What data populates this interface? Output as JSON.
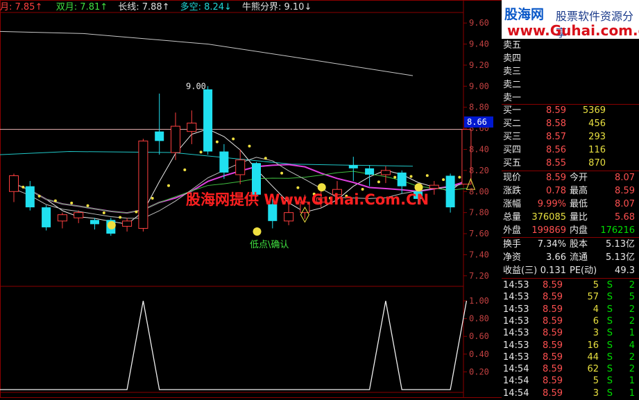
{
  "header": {
    "items": [
      {
        "label": "月:",
        "value": "7.85",
        "arrow": "↑",
        "color": "#ff4040"
      },
      {
        "label": "双月:",
        "value": "7.81",
        "arrow": "↑",
        "color": "#40e040"
      },
      {
        "label": "长线:",
        "value": "7.88",
        "arrow": "↑",
        "color": "#e0e0e0"
      },
      {
        "label": "多空:",
        "value": "8.24",
        "arrow": "↓",
        "color": "#20d8d8"
      },
      {
        "label": "牛熊分界:",
        "value": "9.10",
        "arrow": "↓",
        "color": "#e0e0e0"
      }
    ]
  },
  "price_axis": {
    "ticks": [
      "9.60",
      "9.40",
      "9.20",
      "9.00",
      "8.80",
      "8.60",
      "8.40",
      "8.20",
      "8.00",
      "7.80",
      "7.60",
      "7.40",
      "7.20"
    ],
    "current": "8.66"
  },
  "indicator_axis": {
    "ticks": [
      "1.00",
      "0.80",
      "0.60",
      "0.40",
      "0.20"
    ]
  },
  "annotations": {
    "high_label": "9.00",
    "low_label": "低点\\确认",
    "watermark": "股海网提供 Www.Guhai.Com.CN"
  },
  "chart_data": {
    "type": "candlestick",
    "candles": [
      {
        "o": 8.0,
        "c": 8.15,
        "h": 8.17,
        "l": 7.9,
        "up": true
      },
      {
        "o": 8.05,
        "c": 7.85,
        "h": 8.1,
        "l": 7.82,
        "up": false
      },
      {
        "o": 7.85,
        "c": 7.66,
        "h": 7.87,
        "l": 7.63,
        "up": false
      },
      {
        "o": 7.72,
        "c": 7.78,
        "h": 7.8,
        "l": 7.65,
        "up": true
      },
      {
        "o": 7.75,
        "c": 7.8,
        "h": 7.82,
        "l": 7.7,
        "up": true
      },
      {
        "o": 7.73,
        "c": 7.69,
        "h": 7.75,
        "l": 7.64,
        "up": false
      },
      {
        "o": 7.73,
        "c": 7.6,
        "h": 7.75,
        "l": 7.58,
        "up": false
      },
      {
        "o": 7.67,
        "c": 7.72,
        "h": 7.75,
        "l": 7.62,
        "up": true
      },
      {
        "o": 7.65,
        "c": 8.48,
        "h": 8.5,
        "l": 7.62,
        "up": true
      },
      {
        "o": 8.48,
        "c": 8.57,
        "h": 8.93,
        "l": 8.35,
        "up": false
      },
      {
        "o": 8.37,
        "c": 8.62,
        "h": 8.75,
        "l": 8.3,
        "up": true
      },
      {
        "o": 8.57,
        "c": 8.65,
        "h": 8.77,
        "l": 8.45,
        "up": true
      },
      {
        "o": 8.97,
        "c": 8.38,
        "h": 9.0,
        "l": 8.35,
        "up": false
      },
      {
        "o": 8.38,
        "c": 8.18,
        "h": 8.45,
        "l": 8.12,
        "up": false
      },
      {
        "o": 8.16,
        "c": 8.3,
        "h": 8.4,
        "l": 8.07,
        "up": true
      },
      {
        "o": 8.27,
        "c": 7.97,
        "h": 8.28,
        "l": 7.95,
        "up": false
      },
      {
        "o": 7.88,
        "c": 7.72,
        "h": 7.93,
        "l": 7.65,
        "up": false
      },
      {
        "o": 7.72,
        "c": 7.8,
        "h": 7.95,
        "l": 7.68,
        "up": true
      },
      {
        "o": 7.8,
        "c": 7.9,
        "h": 7.97,
        "l": 7.74,
        "up": true
      },
      {
        "o": 7.9,
        "c": 7.94,
        "h": 8.02,
        "l": 7.85,
        "up": true
      },
      {
        "o": 7.97,
        "c": 8.02,
        "h": 8.1,
        "l": 7.9,
        "up": true
      },
      {
        "o": 8.22,
        "c": 8.25,
        "h": 8.33,
        "l": 8.1,
        "up": false
      },
      {
        "o": 8.22,
        "c": 8.16,
        "h": 8.25,
        "l": 8.05,
        "up": false
      },
      {
        "o": 8.16,
        "c": 8.2,
        "h": 8.24,
        "l": 8.08,
        "up": true
      },
      {
        "o": 8.18,
        "c": 8.05,
        "h": 8.2,
        "l": 7.98,
        "up": false
      },
      {
        "o": 8.0,
        "c": 7.93,
        "h": 8.05,
        "l": 7.88,
        "up": false
      },
      {
        "o": 8.03,
        "c": 8.06,
        "h": 8.1,
        "l": 7.97,
        "up": true
      },
      {
        "o": 8.15,
        "c": 7.85,
        "h": 8.17,
        "l": 7.8,
        "up": false
      },
      {
        "o": 8.07,
        "c": 8.59,
        "h": 8.59,
        "l": 8.07,
        "up": true
      }
    ],
    "indicator": [
      0,
      0,
      0,
      0,
      0,
      0,
      0,
      0,
      1,
      0,
      0,
      0,
      0,
      0,
      0,
      0,
      0,
      0,
      0,
      0,
      0,
      0,
      0,
      1,
      0,
      0,
      0,
      0,
      1
    ]
  },
  "order_book": {
    "sell": [
      {
        "label": "卖五",
        "price": "",
        "vol": ""
      },
      {
        "label": "卖四",
        "price": "",
        "vol": ""
      },
      {
        "label": "卖三",
        "price": "",
        "vol": ""
      },
      {
        "label": "卖二",
        "price": "",
        "vol": ""
      },
      {
        "label": "卖一",
        "price": "",
        "vol": ""
      }
    ],
    "buy": [
      {
        "label": "买一",
        "price": "8.59",
        "vol": "5369"
      },
      {
        "label": "买二",
        "price": "8.58",
        "vol": "456"
      },
      {
        "label": "买三",
        "price": "8.57",
        "vol": "293"
      },
      {
        "label": "买四",
        "price": "8.56",
        "vol": "116"
      },
      {
        "label": "买五",
        "price": "8.55",
        "vol": "870"
      }
    ]
  },
  "quote": {
    "rows": [
      [
        {
          "l": "现价",
          "v": "8.59",
          "c": "red"
        },
        {
          "l": "今开",
          "v": "8.07",
          "c": "red"
        }
      ],
      [
        {
          "l": "涨跌",
          "v": "0.78",
          "c": "red"
        },
        {
          "l": "最高",
          "v": "8.59",
          "c": "red"
        }
      ],
      [
        {
          "l": "涨幅",
          "v": "9.99%",
          "c": "red"
        },
        {
          "l": "最低",
          "v": "8.07",
          "c": "red"
        }
      ],
      [
        {
          "l": "总量",
          "v": "376085",
          "c": "yel"
        },
        {
          "l": "量比",
          "v": "5.68",
          "c": "red"
        }
      ],
      [
        {
          "l": "外盘",
          "v": "199869",
          "c": "red"
        },
        {
          "l": "内盘",
          "v": "176216",
          "c": "grn"
        }
      ]
    ],
    "rows2": [
      [
        {
          "l": "换手",
          "v": "7.34%",
          "c": "wht"
        },
        {
          "l": "股本",
          "v": "5.13亿",
          "c": "wht"
        }
      ],
      [
        {
          "l": "净资",
          "v": "3.66",
          "c": "wht"
        },
        {
          "l": "流通",
          "v": "5.13亿",
          "c": "wht"
        }
      ],
      [
        {
          "l": "收益(三)",
          "v": "0.131",
          "c": "wht"
        },
        {
          "l": "PE(动)",
          "v": "49.3",
          "c": "wht"
        }
      ]
    ]
  },
  "ticks": [
    {
      "t": "14:53",
      "p": "8.59",
      "v": "5",
      "s": "S",
      "n": "2"
    },
    {
      "t": "14:53",
      "p": "8.59",
      "v": "57",
      "s": "S",
      "n": "5"
    },
    {
      "t": "14:53",
      "p": "8.59",
      "v": "4",
      "s": "S",
      "n": "2"
    },
    {
      "t": "14:53",
      "p": "8.59",
      "v": "6",
      "s": "S",
      "n": "2"
    },
    {
      "t": "14:53",
      "p": "8.59",
      "v": "3",
      "s": "S",
      "n": "1"
    },
    {
      "t": "14:53",
      "p": "8.59",
      "v": "16",
      "s": "S",
      "n": "4"
    },
    {
      "t": "14:53",
      "p": "8.59",
      "v": "44",
      "s": "S",
      "n": "2"
    },
    {
      "t": "14:54",
      "p": "8.59",
      "v": "62",
      "s": "S",
      "n": "2"
    },
    {
      "t": "14:54",
      "p": "8.59",
      "v": "5",
      "s": "S",
      "n": "1"
    },
    {
      "t": "14:54",
      "p": "8.59",
      "v": "3",
      "s": "S",
      "n": "1"
    }
  ],
  "logo": {
    "name": "股海网",
    "slogan": "股票软件资源分享",
    "url": "www.Guhai.com.cn"
  }
}
